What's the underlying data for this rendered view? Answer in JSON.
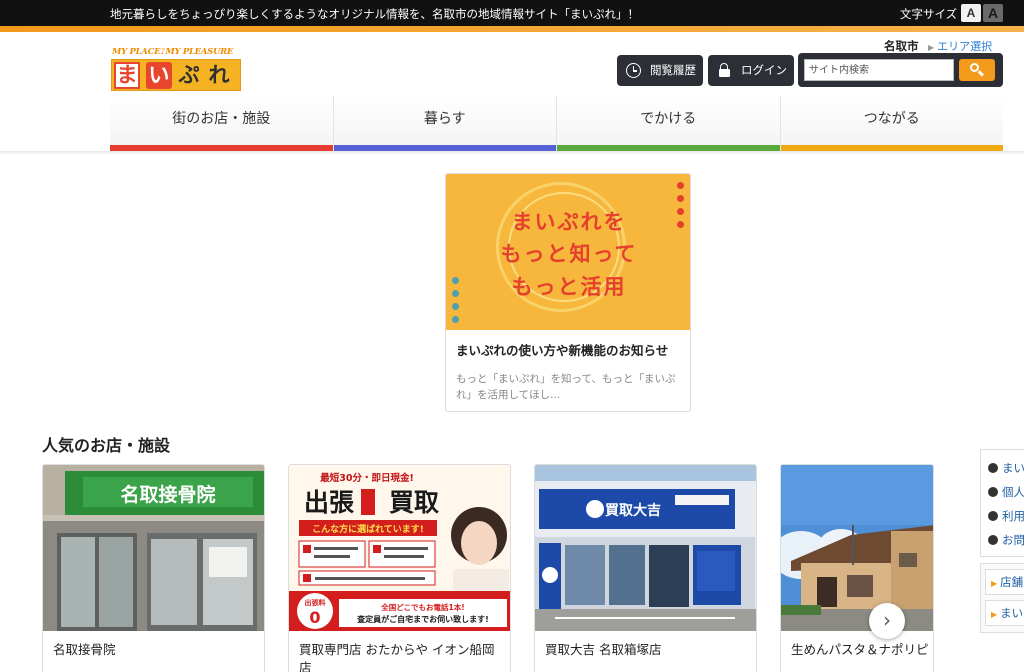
{
  "topbar": {
    "tagline": "地元暮らしをちょっぴり楽しくするようなオリジナル情報を、名取市の地域情報サイト「まいぷれ」！",
    "font_size_label": "文字サイズ",
    "font_small": "A",
    "font_large": "A"
  },
  "header": {
    "logo_tagline": "MY PLACE♪MY PLEASURE",
    "logo_chars": [
      "ま",
      "い",
      "ぷ",
      "れ"
    ],
    "city": "名取市",
    "area_select": "エリア選択",
    "history_label": "閲覧履歴",
    "login_label": "ログイン",
    "search_placeholder": "サイト内検索"
  },
  "nav": {
    "items": [
      {
        "label": "街のお店・施設",
        "color": "#e53b30"
      },
      {
        "label": "暮らす",
        "color": "#5661d8"
      },
      {
        "label": "でかける",
        "color": "#5aa83c"
      },
      {
        "label": "つながる",
        "color": "#eeaa10"
      }
    ]
  },
  "feature": {
    "banner_lines": [
      "まいぷれを",
      "もっと知って",
      "もっと活用"
    ],
    "title": "まいぷれの使い方や新機能のお知らせ",
    "description": "もっと「まいぷれ」を知って、もっと「まいぷれ」を活用してほし..."
  },
  "popular": {
    "title": "人気のお店・施設",
    "shops": [
      {
        "name": "名取接骨院",
        "sign": "名取接骨院"
      },
      {
        "name": "買取専門店 おたからや イオン船岡店",
        "ad_top": "最短30分・即日現金!",
        "ad_main": "出張",
        "ad_main2": "買取",
        "ad_sub": "こんな方に選ばれています!",
        "ad_fee": "出張料",
        "ad_zero": "0",
        "ad_call": "全国どこでもお電話1本!",
        "ad_call2": "査定員がご自宅までお伺い致します!"
      },
      {
        "name": "買取大吉 名取箱塚店",
        "sign": "買取大吉"
      },
      {
        "name": "生めんパスタ＆ナポリピ パン亘理"
      }
    ]
  },
  "sidebar": {
    "links": [
      "まい",
      "個人",
      "利用",
      "お問"
    ],
    "buttons": [
      "店舗",
      "まい"
    ]
  }
}
